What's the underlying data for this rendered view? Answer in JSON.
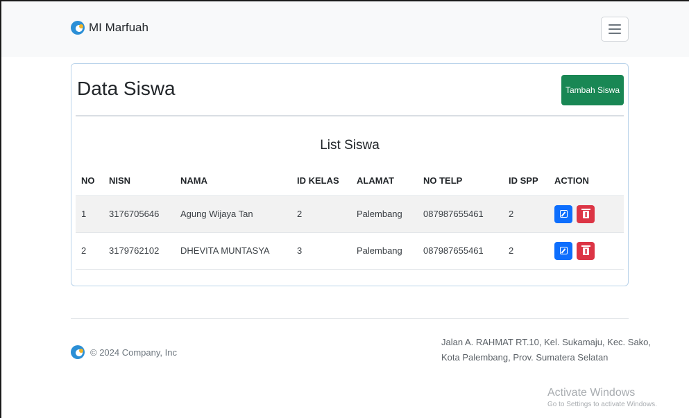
{
  "navbar": {
    "brand": "MI Marfuah",
    "logo_icon": "school-logo-icon",
    "toggler_icon": "hamburger-menu-icon"
  },
  "card": {
    "title": "Data Siswa",
    "add_button": "Tambah Siswa",
    "list_title": "List Siswa"
  },
  "table": {
    "headers": [
      "NO",
      "NISN",
      "NAMA",
      "ID KELAS",
      "ALAMAT",
      "NO TELP",
      "ID SPP",
      "ACTION"
    ],
    "rows": [
      {
        "no": "1",
        "nisn": "3176705646",
        "nama": "Agung Wijaya Tan",
        "id_kelas": "2",
        "alamat": "Palembang",
        "no_telp": "087987655461",
        "id_spp": "2"
      },
      {
        "no": "2",
        "nisn": "3179762102",
        "nama": "DHEVITA MUNTASYA",
        "id_kelas": "3",
        "alamat": "Palembang",
        "no_telp": "087987655461",
        "id_spp": "2"
      }
    ],
    "edit_icon": "edit-icon",
    "delete_icon": "trash-icon"
  },
  "footer": {
    "copyright": "© 2024 Company, Inc",
    "address_line1": "Jalan A. RAHMAT RT.10, Kel. Sukamaju, Kec. Sako,",
    "address_line2": "Kota Palembang, Prov. Sumatera Selatan"
  },
  "watermark": {
    "title": "Activate Windows",
    "subtitle": "Go to Settings to activate Windows."
  },
  "colors": {
    "primary": "#0d6efd",
    "success": "#198754",
    "danger": "#dc3545"
  }
}
